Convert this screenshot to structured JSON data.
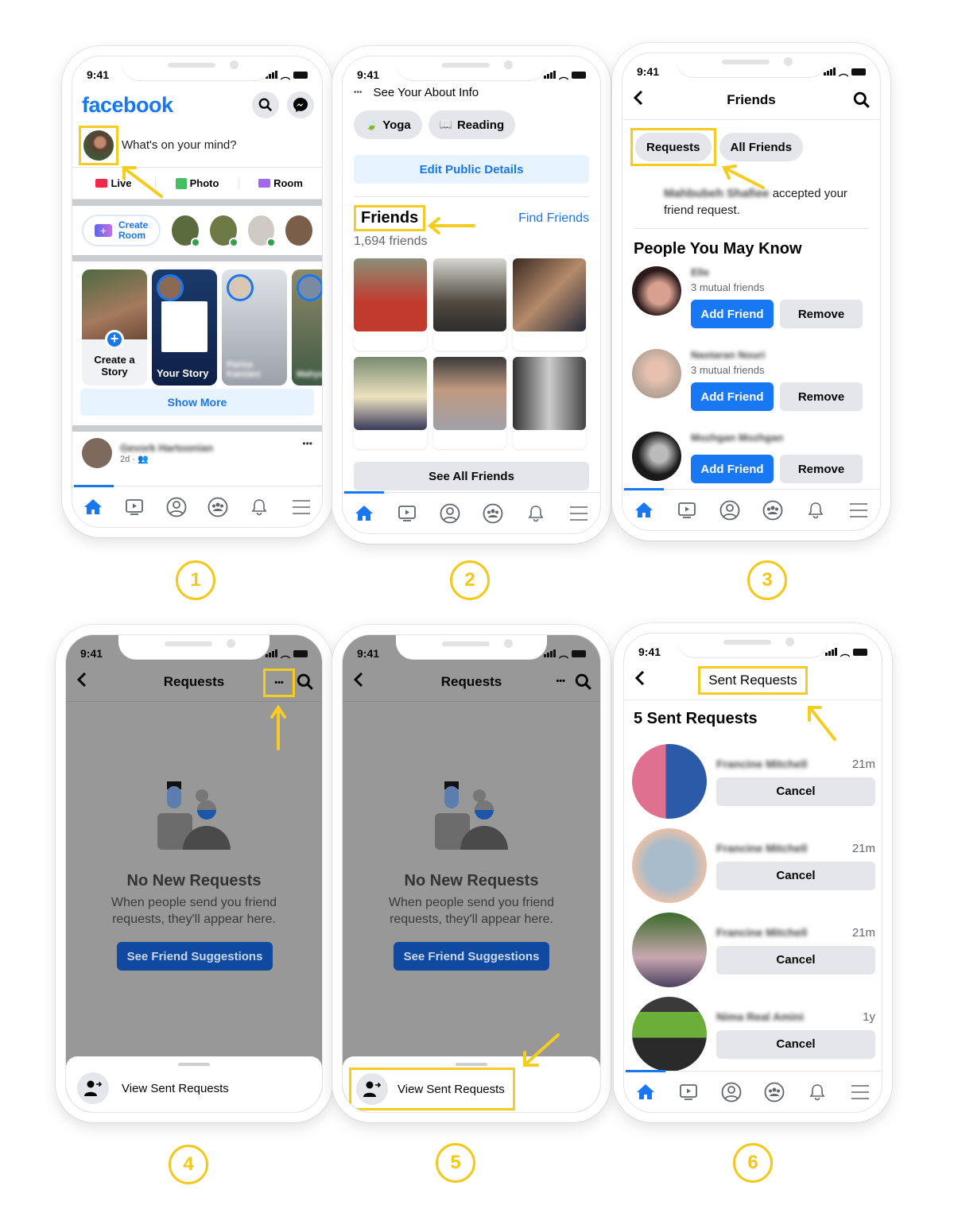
{
  "common": {
    "time": "9:41",
    "tabbar_icons": [
      "home-icon",
      "watch-icon",
      "profile-icon",
      "groups-icon",
      "notifications-icon",
      "menu-icon"
    ]
  },
  "steps": [
    "1",
    "2",
    "3",
    "4",
    "5",
    "6"
  ],
  "phone1": {
    "logo": "facebook",
    "composer_placeholder": "What's on your mind?",
    "actions": [
      {
        "label": "Live",
        "icon": "live-video-icon",
        "color": "#f02849"
      },
      {
        "label": "Photo",
        "icon": "photo-icon",
        "color": "#45bd62"
      },
      {
        "label": "Room",
        "icon": "room-icon",
        "color": "#a366f0"
      }
    ],
    "create_room": "Create Room",
    "create_room_l1": "Create",
    "create_room_l2": "Room",
    "stories": [
      {
        "label": "Create a Story"
      },
      {
        "label": "Your Story"
      },
      {
        "label": "Parisa Kamiani",
        "blurred": true
      },
      {
        "label": "Mahya Zareh",
        "blurred": true
      }
    ],
    "create_story_l1": "Create a",
    "create_story_l2": "Story",
    "your_story": "Your Story",
    "story3_name": "Parisa Kamiani",
    "story4_name": "Mahya Zareh",
    "show_more": "Show More",
    "post_author": "Gevork Hartoonian",
    "post_meta": "2d · 👥",
    "more": "•••"
  },
  "phone2": {
    "about": "See Your About Info",
    "hobbies": [
      {
        "label": "Yoga",
        "icon": "🍃"
      },
      {
        "label": "Reading",
        "icon": "📖"
      }
    ],
    "edit_public": "Edit Public Details",
    "friends_title": "Friends",
    "find_friends": "Find Friends",
    "friends_count": "1,694 friends",
    "see_all": "See All Friends"
  },
  "phone3": {
    "title": "Friends",
    "chips": [
      "Requests",
      "All Friends"
    ],
    "accepted_name": "Mahbubeh Shafiee",
    "accepted_text": "accepted your friend request.",
    "pymk_title": "People You May Know",
    "people": [
      {
        "name": "Elle",
        "mutual": "3 mutual friends"
      },
      {
        "name": "Nastaran Nouri",
        "mutual": "3 mutual friends"
      },
      {
        "name": "Mozhgan Mozhgan",
        "mutual": ""
      }
    ],
    "add_friend": "Add Friend",
    "remove": "Remove"
  },
  "phone4": {
    "title": "Requests",
    "more": "•••",
    "empty_title": "No New Requests",
    "empty_text": "When people send you friend requests, they'll appear here.",
    "suggestions_button": "See Friend Suggestions",
    "sheet_item": "View Sent Requests"
  },
  "phone5": {
    "title": "Requests",
    "more": "•••",
    "empty_title": "No New Requests",
    "empty_text": "When people send you friend requests, they'll appear here.",
    "suggestions_button": "See Friend Suggestions",
    "sheet_item": "View Sent Requests"
  },
  "phone6": {
    "title": "Sent Requests",
    "count_title": "5 Sent Requests",
    "requests": [
      {
        "name": "Francine Mitchell",
        "time": "21m"
      },
      {
        "name": "Francine Mitchell",
        "time": "21m"
      },
      {
        "name": "Francine Mitchell",
        "time": "21m"
      },
      {
        "name": "Nima Real Amini",
        "time": "1y"
      }
    ],
    "cancel": "Cancel"
  },
  "colors": {
    "brand": "#1877f2",
    "highlight": "#f5cc20",
    "dim_blue": "#0f4aa0"
  }
}
